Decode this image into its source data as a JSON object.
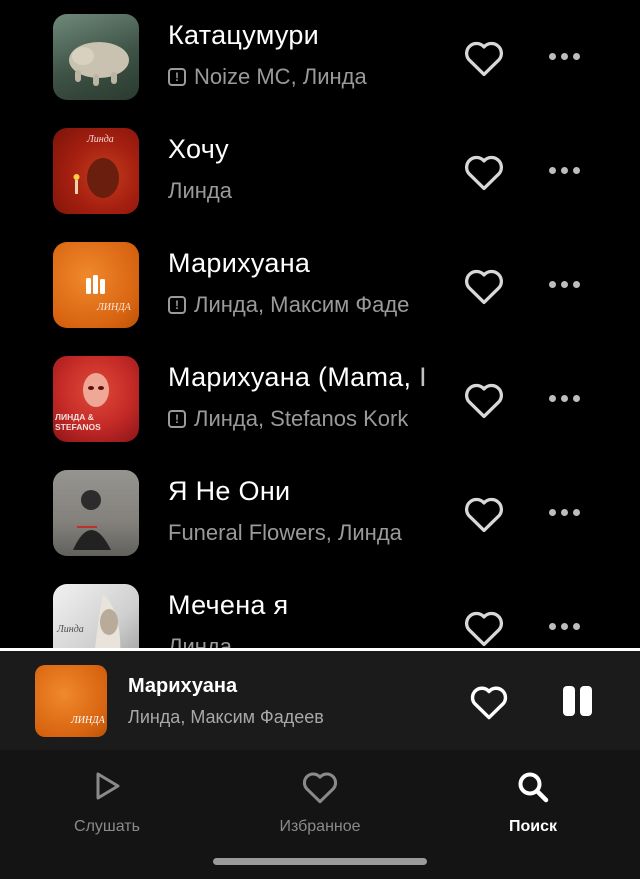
{
  "tracks": [
    {
      "title": "Катацумури",
      "artist": "Noize MC, Линда",
      "explicit": true
    },
    {
      "title": "Хочу",
      "artist": "Линда",
      "explicit": false
    },
    {
      "title": "Марихуана",
      "artist": "Линда, Максим Фаде",
      "explicit": true,
      "playing": true
    },
    {
      "title": "Марихуана (Mama, I",
      "artist": "Линда, Stefanos Kork",
      "explicit": true
    },
    {
      "title": "Я Не Они",
      "artist": "Funeral Flowers, Линда",
      "explicit": false
    },
    {
      "title": "Мечена я",
      "artist": "Линда",
      "explicit": false
    }
  ],
  "cover_text": {
    "cover2": "Линда",
    "cover3": "ЛИНДА",
    "cover4": "ЛИНДА & STEFANOS",
    "cover6": "Линда"
  },
  "player": {
    "title": "Марихуана",
    "artist": "Линда, Максим Фадеев",
    "cover_text": "ЛИНДА"
  },
  "nav": {
    "listen": "Слушать",
    "favorites": "Избранное",
    "search": "Поиск"
  },
  "colors": {
    "background": "#000000",
    "player_bg": "#1b1b1b",
    "nav_bg": "#141414",
    "secondary_text": "#9a9a9a",
    "accent": "#ffffff"
  },
  "icons": [
    "explicit-icon",
    "heart-icon",
    "more-icon",
    "pause-icon",
    "play-icon",
    "search-icon"
  ]
}
